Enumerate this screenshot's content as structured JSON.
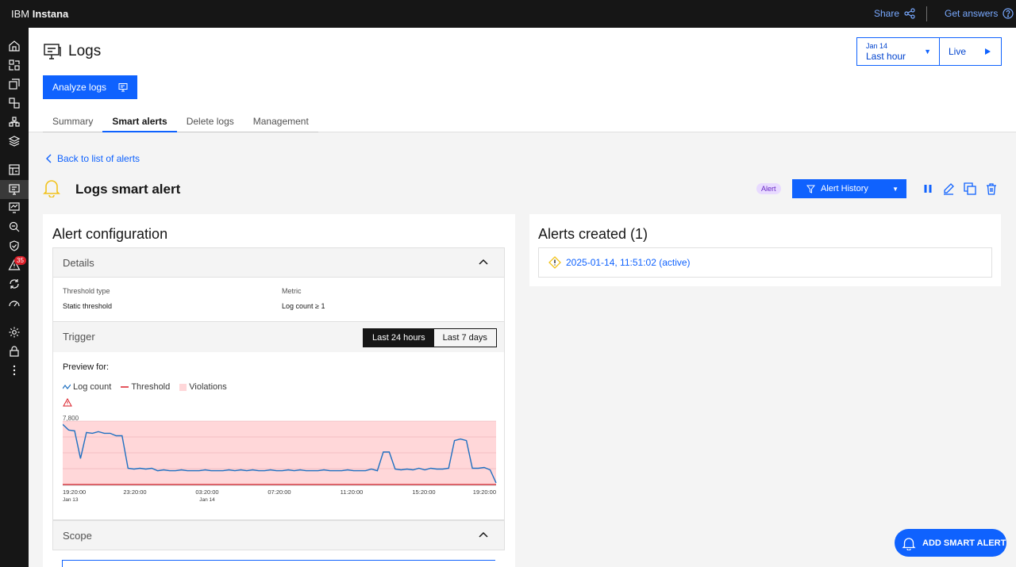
{
  "topbar": {
    "brand_prefix": "IBM",
    "brand_product": "Instana",
    "share_label": "Share",
    "answers_label": "Get answers"
  },
  "sidebar": {
    "items": [
      "home-icon",
      "applications-icon",
      "services-icon",
      "infrastructure-icon",
      "platforms-icon",
      "layers-icon",
      "dashboards-icon",
      "logs-icon",
      "synthetics-icon",
      "analytics-icon",
      "security-icon",
      "events-icon",
      "automation-icon",
      "performance-icon",
      "settings-icon",
      "lock-icon",
      "more-icon"
    ],
    "active_item": "logs-icon",
    "events_badge": "35"
  },
  "header": {
    "title": "Logs",
    "analyze_label": "Analyze logs",
    "time_date": "Jan 14",
    "time_range": "Last hour",
    "live_label": "Live"
  },
  "tabs": [
    {
      "label": "Summary",
      "active": false
    },
    {
      "label": "Smart alerts",
      "active": true
    },
    {
      "label": "Delete logs",
      "active": false
    },
    {
      "label": "Management",
      "active": false
    }
  ],
  "alert": {
    "back_label": "Back to list of alerts",
    "title": "Logs smart alert",
    "tag": "Alert",
    "history_label": "Alert History"
  },
  "config": {
    "title": "Alert configuration",
    "details_label": "Details",
    "threshold_type_label": "Threshold type",
    "threshold_type_value": "Static threshold",
    "metric_label": "Metric",
    "metric_value": "Log count ≥ 1",
    "trigger_label": "Trigger",
    "range_options": [
      "Last 24 hours",
      "Last 7 days"
    ],
    "range_selected": "Last 24 hours",
    "preview_label": "Preview for:",
    "legend": [
      "Log count",
      "Threshold",
      "Violations"
    ],
    "scope_label": "Scope"
  },
  "chart_data": {
    "type": "line",
    "ylim": [
      0,
      7800
    ],
    "y_tick_label": "7,800",
    "x_ticks": [
      {
        "time": "19:20:00",
        "sub": "Jan 13"
      },
      {
        "time": "23:20:00",
        "sub": ""
      },
      {
        "time": "03:20:00",
        "sub": "Jan 14"
      },
      {
        "time": "07:20:00",
        "sub": ""
      },
      {
        "time": "11:20:00",
        "sub": ""
      },
      {
        "time": "15:20:00",
        "sub": ""
      },
      {
        "time": "19:20:00",
        "sub": ""
      }
    ],
    "threshold": 1,
    "series": [
      {
        "name": "Log count",
        "color": "#1f70c1",
        "values": [
          7400,
          6700,
          6600,
          3200,
          6400,
          6300,
          6500,
          6300,
          6300,
          6000,
          6000,
          2000,
          1900,
          2000,
          1900,
          2000,
          1700,
          1800,
          1700,
          1700,
          1800,
          1700,
          1700,
          1700,
          1800,
          1700,
          1700,
          1700,
          1800,
          1700,
          1800,
          1700,
          1800,
          1700,
          1700,
          1800,
          1700,
          1700,
          1800,
          1700,
          1800,
          1700,
          1700,
          1700,
          1800,
          1700,
          1700,
          1700,
          1800,
          1700,
          1700,
          1700,
          1900,
          1700,
          4000,
          4000,
          1900,
          1800,
          1900,
          1800,
          2000,
          1800,
          2000,
          1900,
          1900,
          2000,
          5400,
          5600,
          5400,
          2000,
          2000,
          2100,
          1800,
          200
        ]
      }
    ],
    "violations_color": "#ffd7d9",
    "threshold_color": "#da1e28"
  },
  "created": {
    "title": "Alerts created (1)",
    "entry": "2025-01-14, 11:51:02 (active)"
  },
  "fab_label": "ADD SMART ALERT"
}
